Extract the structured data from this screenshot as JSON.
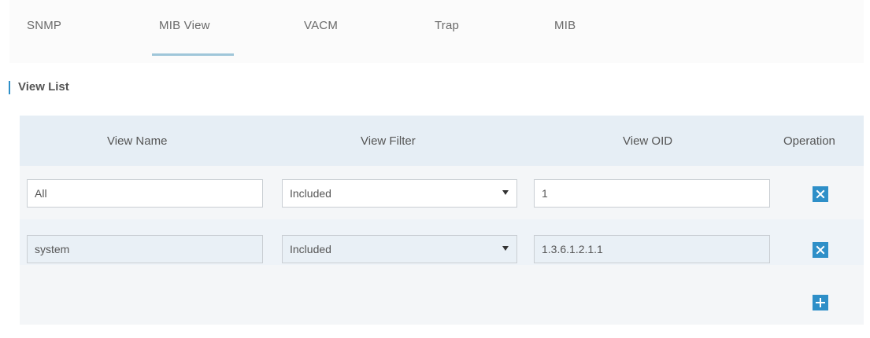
{
  "tabs": [
    {
      "label": "SNMP"
    },
    {
      "label": "MIB View",
      "active": true
    },
    {
      "label": "VACM"
    },
    {
      "label": "Trap"
    },
    {
      "label": "MIB"
    }
  ],
  "section": {
    "title": "View List"
  },
  "table": {
    "headers": [
      "View Name",
      "View Filter",
      "View OID",
      "Operation"
    ],
    "rows": [
      {
        "view_name": "All",
        "view_filter": "Included",
        "view_oid": "1"
      },
      {
        "view_name": "system",
        "view_filter": "Included",
        "view_oid": "1.3.6.1.2.1.1"
      }
    ]
  },
  "icons": {
    "delete": "close-icon",
    "add": "plus-icon"
  },
  "colors": {
    "accent": "#2e8fc8",
    "header_bg": "#e6eef5",
    "active_tab_underline": "#9fc6d9"
  }
}
